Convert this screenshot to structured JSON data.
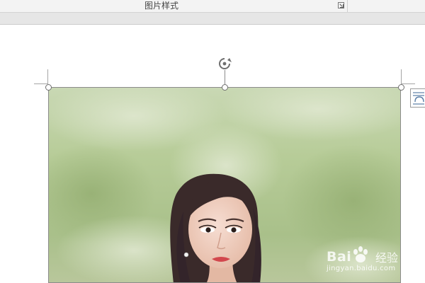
{
  "ribbon": {
    "group_label": "图片样式",
    "launcher_icon": "dialog-launcher-icon"
  },
  "document": {
    "background": "#ffffff",
    "selection_color": "#6f6f6f"
  },
  "picture": {
    "icons": {
      "rotate": "rotate-handle-icon",
      "layout": "layout-options-icon"
    }
  },
  "watermark": {
    "brand": "Bai",
    "brand_suffix": "经验",
    "url": "jingyan.baidu.com"
  }
}
